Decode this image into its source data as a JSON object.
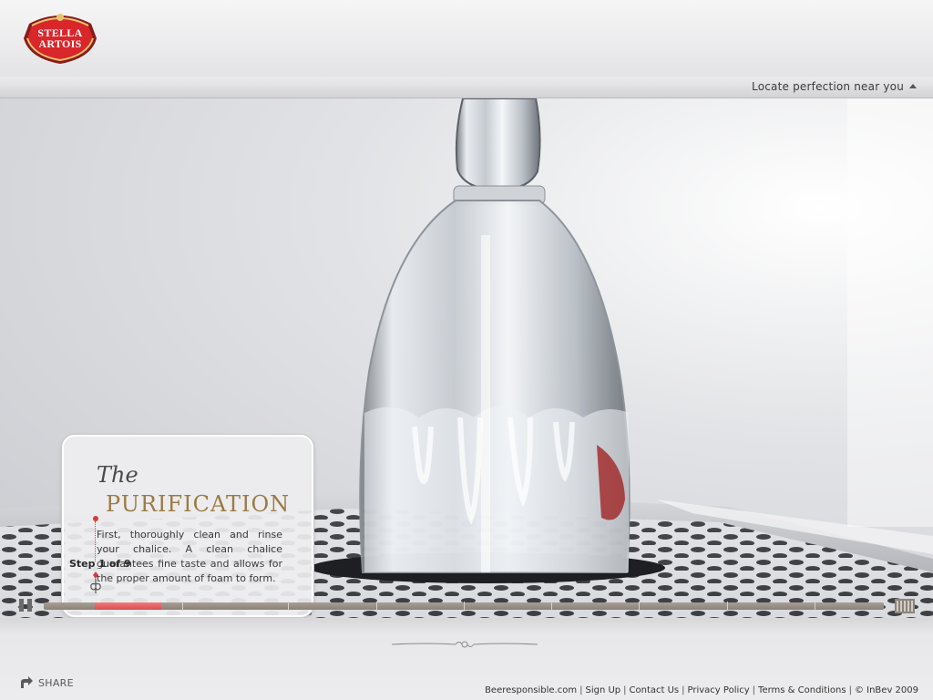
{
  "brand": {
    "logo_line1": "STELLA",
    "logo_line2": "ARTOIS",
    "logo_icon": "stella-artois-crest"
  },
  "topbar": {
    "locate_label": "Locate perfection near you",
    "locate_icon": "triangle-up-icon"
  },
  "card": {
    "prefix": "The",
    "title": "PURIFICATION",
    "body": "First, thoroughly clean and rinse your chalice. A clean chalice guarantees fine taste and allows for the proper amount of foam to form."
  },
  "step": {
    "label": "Step 1 of 9",
    "current": 1,
    "total": 9
  },
  "player": {
    "progress": 0.14,
    "pause_icon": "pause-icon",
    "end_icon": "grille-icon"
  },
  "footer": {
    "share_label": "SHARE",
    "share_icon": "share-arrow-icon",
    "links": [
      "Beeresponsible.com",
      "Sign Up",
      "Contact Us",
      "Privacy Policy",
      "Terms & Conditions"
    ],
    "copyright": "© InBev 2009"
  },
  "colors": {
    "accent_red": "#d83a3a",
    "title_gold": "#9b7b45",
    "progress_track": "#8a8178"
  }
}
